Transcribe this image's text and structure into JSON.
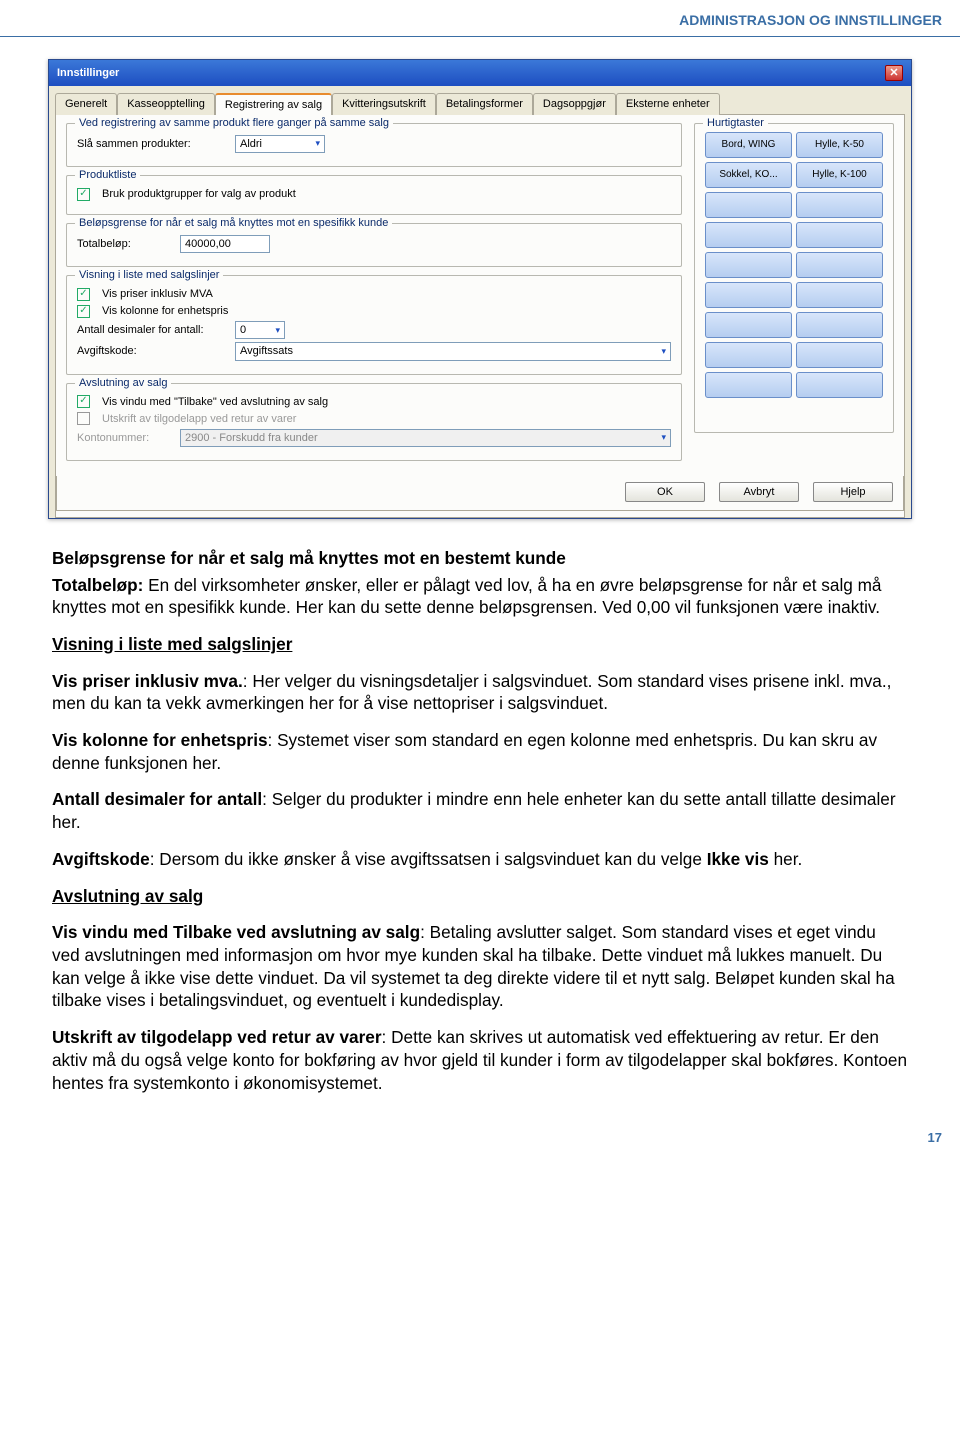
{
  "header": "ADMINISTRASJON OG INNSTILLINGER",
  "page_number": "17",
  "win": {
    "title": "Innstillinger",
    "tabs": [
      "Generelt",
      "Kasseopptelling",
      "Registrering av salg",
      "Kvitteringsutskrift",
      "Betalingsformer",
      "Dagsoppgjør",
      "Eksterne enheter"
    ],
    "active_tab": 2,
    "grp1": {
      "legend": "Ved registrering av samme produkt flere ganger på samme salg",
      "label": "Slå sammen produkter:",
      "value": "Aldri"
    },
    "grp2": {
      "legend": "Produktliste",
      "chk": "Bruk produktgrupper for valg av produkt"
    },
    "grp3": {
      "legend": "Beløpsgrense for når et salg må knyttes mot en spesifikk kunde",
      "label": "Totalbeløp:",
      "value": "40000,00"
    },
    "grp4": {
      "legend": "Visning i liste med salgslinjer",
      "chk1": "Vis priser inklusiv MVA",
      "chk2": "Vis kolonne for enhetspris",
      "label1": "Antall desimaler for antall:",
      "val1": "0",
      "label2": "Avgiftskode:",
      "val2": "Avgiftssats"
    },
    "grp5": {
      "legend": "Avslutning av salg",
      "chk1": "Vis vindu med \"Tilbake\" ved avslutning av salg",
      "chk2": "Utskrift av tilgodelapp ved retur av varer",
      "label": "Kontonummer:",
      "value": "2900 - Forskudd fra kunder"
    },
    "hotkeys": {
      "legend": "Hurtigtaster",
      "items": [
        "Bord, WING",
        "Hylle, K-50",
        "Sokkel, KO...",
        "Hylle, K-100",
        "",
        "",
        "",
        "",
        "",
        "",
        "",
        "",
        "",
        "",
        "",
        "",
        "",
        ""
      ]
    },
    "buttons": {
      "ok": "OK",
      "cancel": "Avbryt",
      "help": "Hjelp"
    }
  },
  "doc": {
    "h1": "Beløpsgrense for når et salg må knyttes mot en bestemt kunde",
    "p1a": "Totalbeløp:",
    "p1b": " En del virksomheter ønsker, eller er pålagt ved lov, å ha en øvre beløpsgrense for når et salg må knyttes mot en spesifikk kunde. Her kan du sette denne beløpsgrensen. Ved 0,00 vil funksjonen være inaktiv.",
    "h2": "Visning i liste med salgslinjer",
    "p2a": "Vis priser inklusiv mva.",
    "p2b": ": Her velger du visningsdetaljer i salgsvinduet. Som standard vises prisene inkl. mva., men du kan ta vekk avmerkingen her for å vise nettopriser i salgsvinduet.",
    "p3a": "Vis kolonne for enhetspris",
    "p3b": ": Systemet viser som standard en egen kolonne med enhetspris. Du kan skru av denne funksjonen her.",
    "p4a": "Antall desimaler for antall",
    "p4b": ": Selger du produkter i mindre enn hele enheter kan du sette antall tillatte desimaler her.",
    "p5a": "Avgiftskode",
    "p5b": ": Dersom du ikke ønsker å vise avgiftssatsen i salgsvinduet kan du velge ",
    "p5c": "Ikke vis",
    "p5d": " her.",
    "h3": "Avslutning av salg",
    "p6a": "Vis vindu med Tilbake ved avslutning av salg",
    "p6b": ": Betaling avslutter salget. Som standard vises et eget vindu ved avslutningen med informasjon om hvor mye kunden skal ha tilbake. Dette vinduet må lukkes manuelt. Du kan velge å ikke vise dette vinduet. Da vil systemet ta deg direkte videre til et nytt salg. Beløpet kunden skal ha tilbake vises i betalingsvinduet, og eventuelt i kundedisplay.",
    "p7a": "Utskrift av tilgodelapp ved retur av varer",
    "p7b": ": Dette kan skrives ut automatisk ved effektuering av retur. Er den aktiv må du også velge konto for bokføring av hvor gjeld til kunder i form av tilgodelapper skal bokføres. Kontoen hentes fra systemkonto i økonomisystemet."
  }
}
